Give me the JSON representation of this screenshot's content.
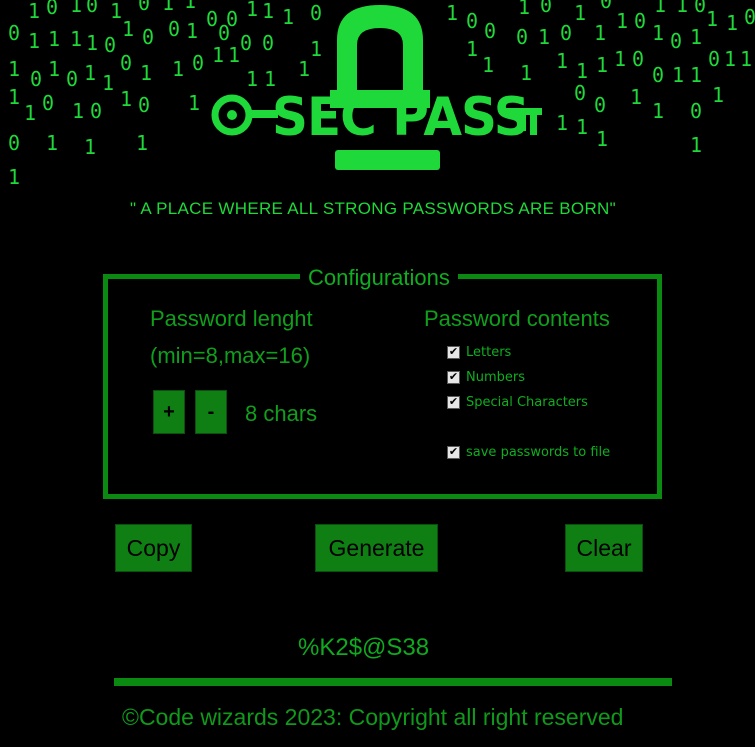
{
  "app": {
    "logo_text": "SEC PASS",
    "tagline": "\" A PLACE WHERE ALL STRONG PASSWORDS ARE BORN\""
  },
  "colors": {
    "background": "#000000",
    "accent": "#1fd93a",
    "button": "#0f7f14",
    "border": "#0b8a12"
  },
  "config": {
    "title": "Configurations",
    "length_label": "Password lenght",
    "length_range": "(min=8,max=16)",
    "increment_label": "+",
    "decrement_label": "-",
    "length_value": "8 chars",
    "contents_label": "Password contents",
    "options": [
      {
        "label": "Letters",
        "checked": true
      },
      {
        "label": "Numbers",
        "checked": true
      },
      {
        "label": "Special Characters",
        "checked": true
      }
    ],
    "save_option": {
      "label": "save passwords to file",
      "checked": true
    }
  },
  "actions": {
    "copy_label": "Copy",
    "generate_label": "Generate",
    "clear_label": "Clear"
  },
  "output": {
    "password": "%K2$@S38"
  },
  "footer": {
    "copyright": "©Code wizards 2023: Copyright all right reserved"
  }
}
